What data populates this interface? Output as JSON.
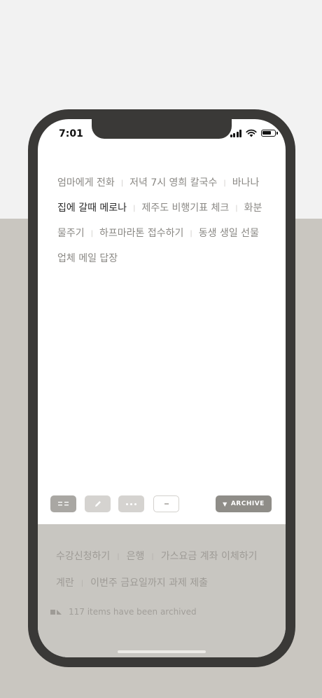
{
  "status_bar": {
    "time": "7:01"
  },
  "tasks": {
    "items": [
      {
        "label": "엄마에게 전화"
      },
      {
        "label": "저녁 7시 영희 칼국수"
      },
      {
        "label": "바나나"
      },
      {
        "label": "집에 갈때 메로나"
      },
      {
        "label": "제주도 비행기표 체크"
      },
      {
        "label": "화분"
      },
      {
        "label": "물주기"
      },
      {
        "label": "하프마라톤 접수하기"
      },
      {
        "label": "동생 생일 선물"
      },
      {
        "label": "업체 메일 답장"
      }
    ]
  },
  "toolbar": {
    "archive_label": "ARCHIVE",
    "icons": [
      "list-icon",
      "pencil-icon",
      "more-icon",
      "minus-icon",
      "triangle-down-icon"
    ]
  },
  "archive": {
    "items": [
      {
        "label": "수강신청하기"
      },
      {
        "label": "은행"
      },
      {
        "label": "가스요금 계좌 이체하기"
      },
      {
        "label": "계란"
      },
      {
        "label": "이번주 금요일까지 과제 제출"
      }
    ],
    "count_text": "117 items have been archived"
  },
  "colors": {
    "background_top": "#f2f2f2",
    "background_bottom": "#c9c6c0",
    "phone_frame": "#3a3937",
    "archive_button": "#8f8d88",
    "archive_panel": "#c8c6c1"
  }
}
